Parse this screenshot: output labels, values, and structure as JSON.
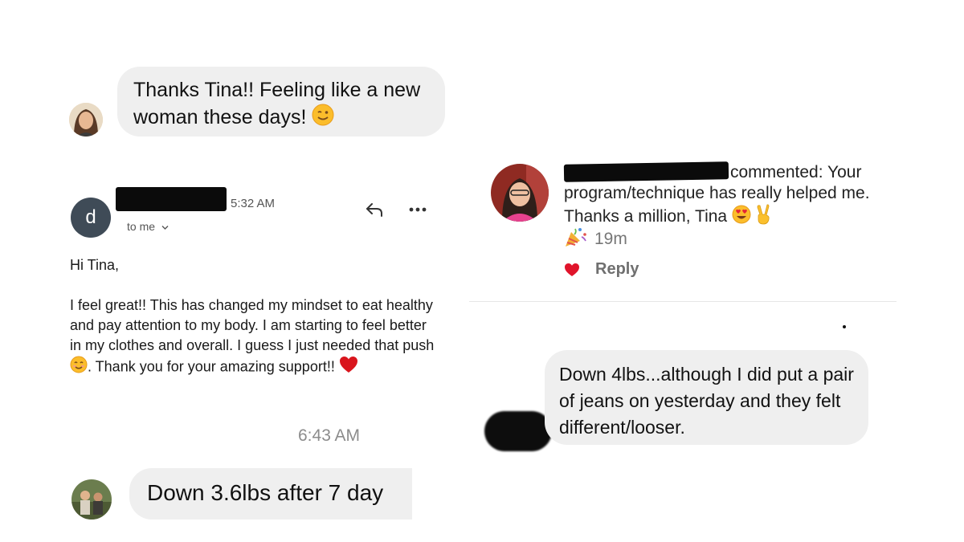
{
  "messages": {
    "top": {
      "text": "Thanks Tina!! Feeling like a new woman these days!",
      "emoji": "winking-face-emoji"
    },
    "bottom": {
      "text": "Down 3.6lbs after 7 day"
    },
    "right": {
      "text": "Down 4lbs...although I did put a pair of jeans on yesterday and they felt different/looser."
    }
  },
  "email": {
    "avatar_letter": "d",
    "time": "5:32 AM",
    "to": "to me",
    "greeting": "Hi Tina,",
    "body_main": "I feel great!! This has changed my mindset to eat healthy and pay attention to my body. I am starting to feel better in my clothes and overall. I guess I just needed that push",
    "body_end": ". Thank you for your amazing support!!",
    "footer_time": "6:43 AM",
    "icons": [
      "reply-icon",
      "more-icon",
      "chevron-down-icon"
    ]
  },
  "comment": {
    "text": "commented: Your program/technique has really helped me. Thanks a million, Tina",
    "time": "19m",
    "reply_label": "Reply",
    "icons": [
      "heart-eyes-emoji",
      "victory-hand-emoji",
      "party-popper-emoji",
      "heart-icon"
    ]
  },
  "colors": {
    "bubble_bg": "#efefef",
    "email_avatar": "#3f4b57",
    "heart": "#e0142b",
    "muted_text": "#6f6f6f"
  }
}
